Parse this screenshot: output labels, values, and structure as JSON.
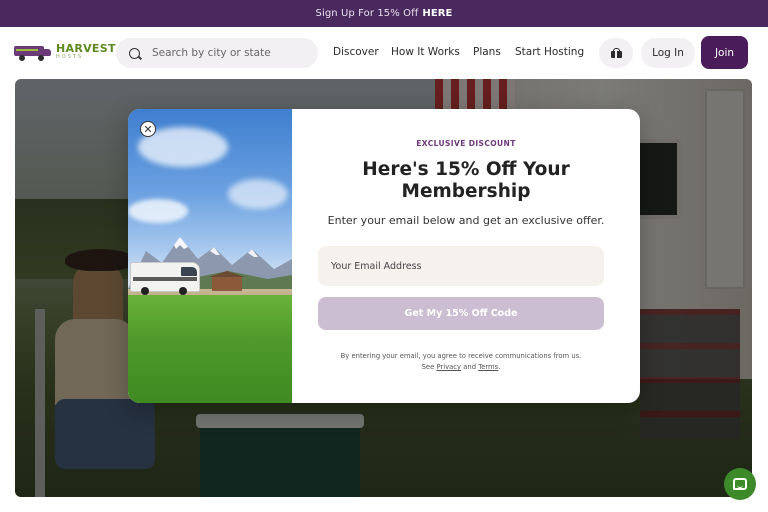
{
  "promo": {
    "text": "Sign Up For 15% Off",
    "link": "HERE"
  },
  "header": {
    "logo": {
      "main": "HARVEST",
      "sub": "HOSTS"
    },
    "search": {
      "placeholder": "Search by city or state"
    },
    "nav": [
      "Discover",
      "How It Works",
      "Plans",
      "Start Hosting"
    ],
    "gift_icon": "gift-icon",
    "login_label": "Log In",
    "join_label": "Join"
  },
  "modal": {
    "close_icon": "close-icon",
    "eyebrow": "EXCLUSIVE DISCOUNT",
    "headline": "Here's 15% Off Your Membership",
    "subtext": "Enter your email below and get an exclusive offer.",
    "email_placeholder": "Your Email Address",
    "cta_label": "Get My 15% Off Code",
    "legal_prefix": "By entering your email, you agree to receive communications from us. See",
    "legal_privacy": "Privacy",
    "legal_and": "and",
    "legal_terms": "Terms",
    "legal_suffix": "."
  },
  "chat_icon": "chat-bubble-icon",
  "colors": {
    "brand_purple": "#4a1d5a",
    "cta_disabled": "#cbbdd2",
    "promo_bg": "#4a2a5e",
    "brand_green": "#5f8a1f"
  }
}
